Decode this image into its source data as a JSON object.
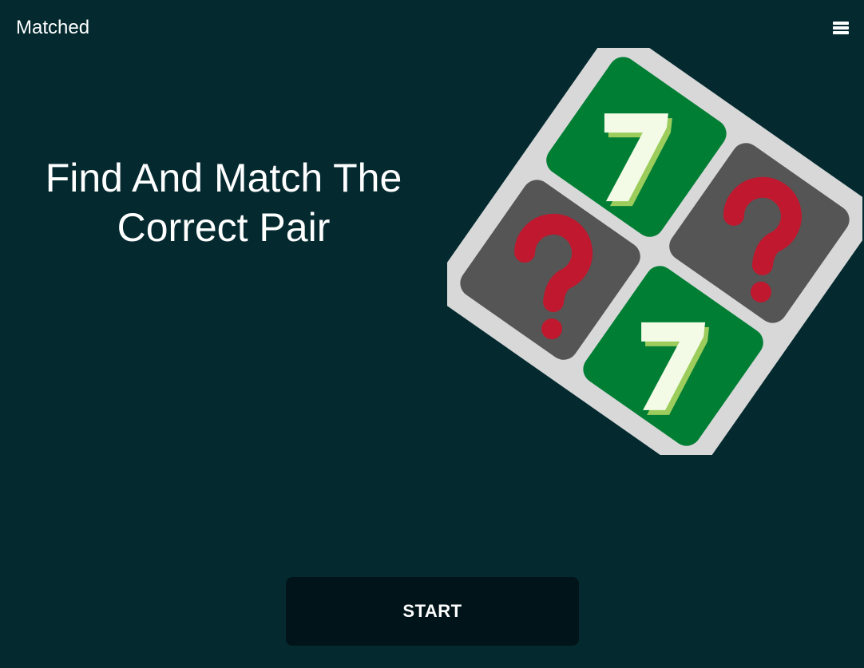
{
  "header": {
    "app_title": "Matched",
    "menu_icon": "hamburger-menu-icon"
  },
  "hero": {
    "headline_line1": "Find And Match The",
    "headline_line2": "Correct Pair",
    "illustration": {
      "tiles": [
        {
          "position": "top",
          "state": "revealed",
          "symbol": "7"
        },
        {
          "position": "left",
          "state": "hidden",
          "symbol": "question-mark-icon"
        },
        {
          "position": "right",
          "state": "hidden",
          "symbol": "question-mark-icon"
        },
        {
          "position": "bottom",
          "state": "revealed",
          "symbol": "7"
        }
      ]
    }
  },
  "actions": {
    "start_label": "START"
  },
  "colors": {
    "background": "#042a30",
    "button_background": "#011419",
    "board_frame": "#d8d8d8",
    "tile_revealed": "#007e34",
    "tile_hidden": "#555555",
    "seven_face": "#f3fbe6",
    "seven_edge": "#9ccc5c",
    "question_mark": "#c0182e",
    "text": "#ffffff"
  }
}
